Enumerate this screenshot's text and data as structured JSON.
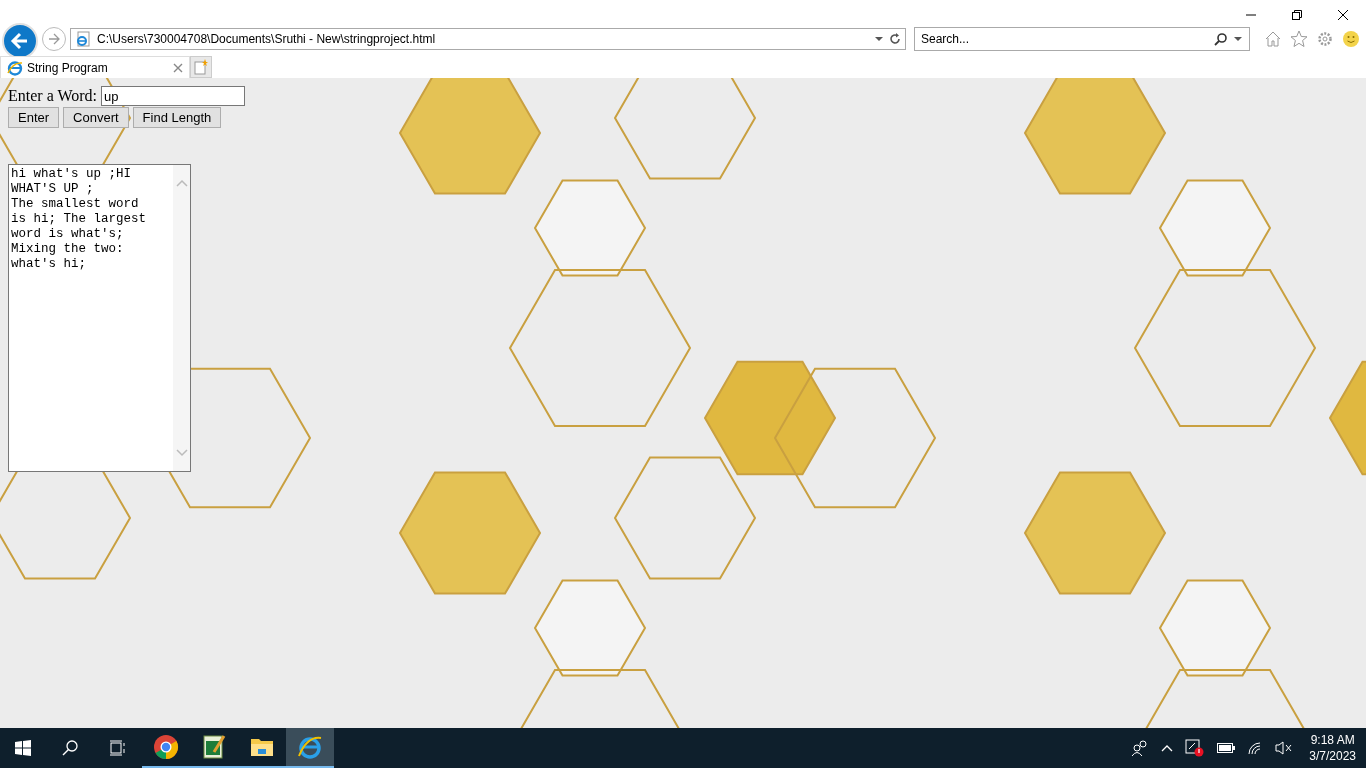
{
  "browser": {
    "address": "C:\\Users\\730004708\\Documents\\Sruthi - New\\stringproject.html",
    "search": {
      "placeholder": "Search..."
    },
    "tabs": [
      {
        "title": "String Program",
        "selected": true
      }
    ]
  },
  "page": {
    "label": "Enter a Word:",
    "input": {
      "value": "up"
    },
    "buttons": [
      "Enter",
      "Convert",
      "Find Length"
    ],
    "output": "hi what's up ;HI WHAT'S UP ;\nThe smallest word is hi; The largest word is what's;\nMixing the two: what's hi;"
  },
  "taskbar": {
    "apps": [
      {
        "kind": "chrome",
        "selected": false
      },
      {
        "kind": "notepad",
        "selected": false
      },
      {
        "kind": "explorer",
        "selected": false
      },
      {
        "kind": "ie",
        "selected": true
      }
    ],
    "time": "9:18 AM",
    "date": "3/7/2023"
  }
}
